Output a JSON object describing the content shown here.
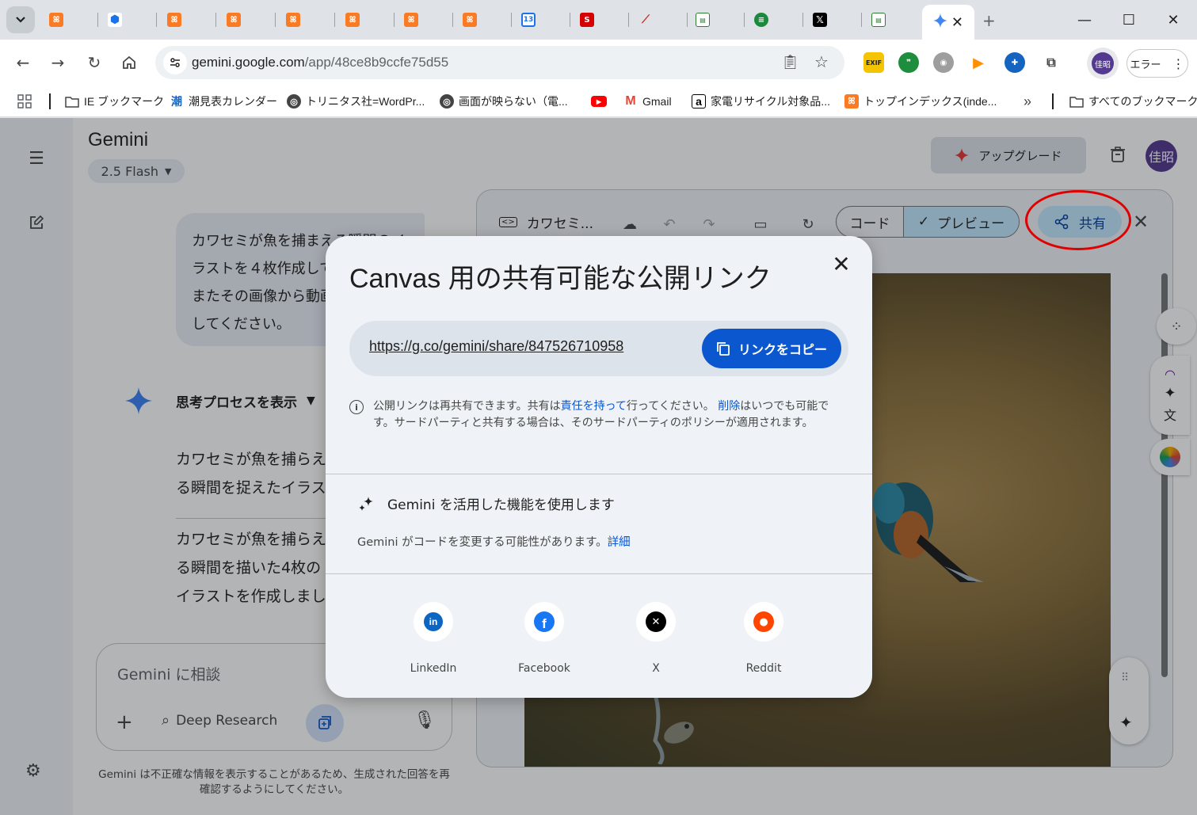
{
  "browser": {
    "tabs": [
      {
        "icon": "xampp-icon"
      },
      {
        "icon": "cube-icon"
      },
      {
        "icon": "xampp-icon"
      },
      {
        "icon": "xampp-icon"
      },
      {
        "icon": "xampp-icon"
      },
      {
        "icon": "xampp-icon"
      },
      {
        "icon": "xampp-icon"
      },
      {
        "icon": "xampp-icon"
      },
      {
        "icon": "calendar-icon",
        "text": "13"
      },
      {
        "icon": "red-logo-icon"
      },
      {
        "icon": "chart-icon"
      },
      {
        "icon": "site-icon"
      },
      {
        "icon": "green-icon"
      },
      {
        "icon": "x-logo-icon"
      },
      {
        "icon": "site-icon"
      }
    ],
    "active_tab_icon": "gemini-sparkle-icon",
    "url_host": "gemini.google.com",
    "url_path": "/app/48ce8b9ccfe75d55",
    "extensions": [
      {
        "icon": "exif-icon",
        "label": "EXIF"
      },
      {
        "icon": "quote-icon",
        "label": "❞"
      },
      {
        "icon": "rss-icon",
        "label": "◉"
      },
      {
        "icon": "play-icon",
        "label": "▶"
      },
      {
        "icon": "extension-blue-icon",
        "label": "✚"
      },
      {
        "icon": "puzzle-icon",
        "label": "⧉"
      }
    ],
    "profile_text": "佳昭",
    "error_label": "エラー"
  },
  "bookmarks": [
    {
      "label": "IE ブックマーク",
      "icon": "folder-icon"
    },
    {
      "label": "潮見表カレンダー",
      "icon": "shio-icon"
    },
    {
      "label": "トリニタス社=WordPr...",
      "icon": "globe-icon"
    },
    {
      "label": "画面が映らない（電...",
      "icon": "globe-icon"
    },
    {
      "label": "",
      "icon": "youtube-icon"
    },
    {
      "label": "Gmail",
      "icon": "gmail-icon"
    },
    {
      "label": "家電リサイクル対象品...",
      "icon": "amazon-icon"
    },
    {
      "label": "トップインデックス(inde...",
      "icon": "xampp-icon"
    }
  ],
  "bookmarks_all": "すべてのブックマーク",
  "bookmark_glyphs": {
    "shio": "潮",
    "amazon": "a",
    "xampp": "ꕤ"
  },
  "gemini": {
    "title": "Gemini",
    "model": "2.5 Flash",
    "upgrade_label": "アップグレード",
    "avatar_text": "佳昭",
    "user_message": "カワセミが魚を捕まえる瞬間のイラストを４枚作成してください。またその画像から動画も１個作成してください。",
    "thinking_label": "思考プロセスを表示",
    "response_1": "カワセミが魚を捕らえる瞬間を捉えたイラストを4枚作成しました。",
    "response_2": "カワセミが魚を捕らえる瞬間を描いた4枚のイラストを作成しました。",
    "input_placeholder": "Gemini に相談",
    "deep_research_label": "Deep Research",
    "disclaimer": "Gemini は不正確な情報を表示することがあるため、生成された回答を再確認するようにしてください。"
  },
  "canvas": {
    "title": "カワセミ...",
    "code_label": "コード",
    "preview_label": "プレビュー",
    "share_label": "共有"
  },
  "share_dialog": {
    "title": "Canvas 用の共有可能な公開リンク",
    "link": "https://g.co/gemini/share/847526710958",
    "copy_label": "リンクをコピー",
    "notice_part1": "公開リンクは再共有できます。共有は",
    "notice_link1": "責任を持って",
    "notice_part2": "行ってください。",
    "notice_link2": "削除",
    "notice_part3": "はいつでも可能です。サードパーティと共有する場合は、そのサードパーティのポリシーが適用されます。",
    "feature_title": "Gemini を活用した機能を使用します",
    "feature_note": "Gemini がコードを変更する可能性があります。",
    "feature_link": "詳細",
    "social": [
      {
        "label": "LinkedIn",
        "icon": "linkedin-icon",
        "color": "#0a66c2"
      },
      {
        "label": "Facebook",
        "icon": "facebook-icon",
        "color": "#1877f2"
      },
      {
        "label": "X",
        "icon": "x-icon",
        "color": "#000000"
      },
      {
        "label": "Reddit",
        "icon": "reddit-icon",
        "color": "#ff4500"
      }
    ]
  },
  "colors": {
    "accent": "#0b57d0",
    "highlight": "#e00000"
  }
}
